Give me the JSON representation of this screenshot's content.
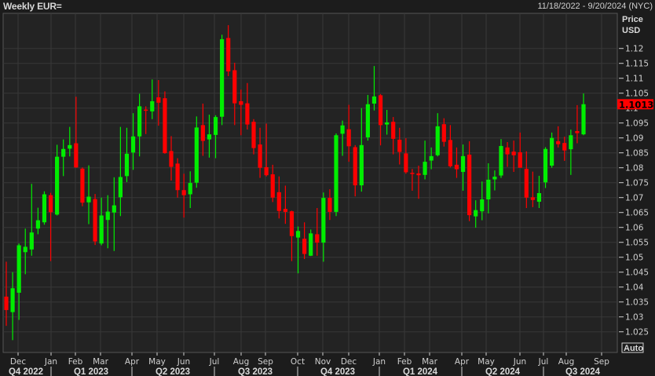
{
  "header": {
    "title": "Weekly EUR=",
    "range": "11/18/2022 - 9/20/2024 (NYC)"
  },
  "chart_data": {
    "type": "candlestick",
    "title": "Weekly EUR=",
    "ylabel": "Price USD",
    "ylabel_lines": [
      "Price",
      "USD"
    ],
    "ylim": [
      1.02,
      1.13
    ],
    "yticks": [
      "1.12",
      "1.115",
      "1.11",
      "1.105",
      "1.1",
      "1.095",
      "1.09",
      "1.085",
      "1.08",
      "1.075",
      "1.07",
      "1.065",
      "1.06",
      "1.055",
      "1.05",
      "1.045",
      "1.04",
      "1.035",
      "1.03",
      "1.025"
    ],
    "grid": true,
    "last_price": "1.1013",
    "scale_button": "Auto",
    "months": [
      "Dec",
      "Jan",
      "Feb",
      "Mar",
      "Apr",
      "May",
      "Jun",
      "Jul",
      "Aug",
      "Sep",
      "Oct",
      "Nov",
      "Dec",
      "Jan",
      "Feb",
      "Mar",
      "Apr",
      "May",
      "Jun",
      "Jul",
      "Aug",
      "Sep"
    ],
    "quarters": [
      "Q4 2022",
      "Q1 2023",
      "Q2 2023",
      "Q3 2023",
      "Q4 2023",
      "Q1 2024",
      "Q2 2024",
      "Q3 2024"
    ],
    "colors": {
      "up": "#00ee00",
      "down": "#ff0000",
      "last_price_bg": "#ff0000"
    },
    "candle_fields": [
      "open",
      "high",
      "low",
      "close"
    ],
    "candles": [
      [
        1.0368,
        1.0485,
        1.027,
        1.0323
      ],
      [
        1.0316,
        1.045,
        1.0222,
        1.0396
      ],
      [
        1.0381,
        1.0546,
        1.029,
        1.054
      ],
      [
        1.0517,
        1.0596,
        1.0443,
        1.0535
      ],
      [
        1.0526,
        1.0746,
        1.0505,
        1.0583
      ],
      [
        1.0596,
        1.0666,
        1.0577,
        1.0624
      ],
      [
        1.0617,
        1.0721,
        1.0609,
        1.0711
      ],
      [
        1.0708,
        1.0716,
        1.0487,
        1.0651
      ],
      [
        1.0643,
        1.0877,
        1.064,
        1.0837
      ],
      [
        1.0837,
        1.0895,
        1.0772,
        1.0863
      ],
      [
        1.0864,
        1.0937,
        1.0838,
        1.0876
      ],
      [
        1.0882,
        1.1038,
        1.08,
        1.0801
      ],
      [
        1.0797,
        1.0801,
        1.0671,
        1.0683
      ],
      [
        1.0684,
        1.0808,
        1.0611,
        1.0703
      ],
      [
        1.0695,
        1.0712,
        1.0541,
        1.0553
      ],
      [
        1.0546,
        1.07,
        1.054,
        1.064
      ],
      [
        1.0625,
        1.0708,
        1.053,
        1.0653
      ],
      [
        1.065,
        1.0768,
        1.0521,
        1.0674
      ],
      [
        1.0701,
        1.0937,
        1.0638,
        1.0769
      ],
      [
        1.0772,
        1.0934,
        1.0752,
        1.0847
      ],
      [
        1.0851,
        1.0983,
        1.0793,
        1.0905
      ],
      [
        1.0905,
        1.1048,
        1.0838,
        1.1006
      ],
      [
        1.0995,
        1.1006,
        1.0913,
        1.0993
      ],
      [
        1.0989,
        1.1096,
        1.0963,
        1.1023
      ],
      [
        1.1036,
        1.1094,
        1.0941,
        1.1018
      ],
      [
        1.1033,
        1.1056,
        1.0847,
        1.0849
      ],
      [
        1.0856,
        1.0906,
        1.0757,
        1.0803
      ],
      [
        1.0814,
        1.0832,
        1.07,
        1.0725
      ],
      [
        1.0725,
        1.078,
        1.0633,
        1.0708
      ],
      [
        1.0711,
        1.0788,
        1.0665,
        1.0749
      ],
      [
        1.075,
        1.0972,
        1.0733,
        1.0935
      ],
      [
        1.0943,
        1.1015,
        1.084,
        1.089
      ],
      [
        1.0895,
        1.0978,
        1.0834,
        1.0912
      ],
      [
        1.091,
        1.0976,
        1.0832,
        1.097
      ],
      [
        1.0971,
        1.1246,
        1.0943,
        1.1231
      ],
      [
        1.1235,
        1.1278,
        1.1107,
        1.1123
      ],
      [
        1.1127,
        1.1152,
        1.0943,
        1.1016
      ],
      [
        1.1023,
        1.1062,
        1.0909,
        1.1011
      ],
      [
        1.1016,
        1.1084,
        1.0928,
        1.0945
      ],
      [
        1.0954,
        1.0963,
        1.0845,
        1.0866
      ],
      [
        1.0878,
        1.0934,
        1.0766,
        1.08
      ],
      [
        1.0802,
        1.0948,
        1.0771,
        1.0775
      ],
      [
        1.0778,
        1.081,
        1.0685,
        1.07
      ],
      [
        1.0718,
        1.0771,
        1.063,
        1.0655
      ],
      [
        1.0662,
        1.074,
        1.0612,
        1.0652
      ],
      [
        1.0654,
        1.0656,
        1.0487,
        1.0571
      ],
      [
        1.0566,
        1.0603,
        1.0446,
        1.0588
      ],
      [
        1.0562,
        1.0617,
        1.0494,
        1.0511
      ],
      [
        1.0505,
        1.0593,
        1.0504,
        1.058
      ],
      [
        1.0577,
        1.0665,
        1.0505,
        1.0549
      ],
      [
        1.0549,
        1.0717,
        1.0485,
        1.0699
      ],
      [
        1.0699,
        1.0728,
        1.0625,
        1.0652
      ],
      [
        1.0652,
        1.0915,
        1.0638,
        1.0909
      ],
      [
        1.0914,
        1.0958,
        1.084,
        1.0942
      ],
      [
        1.0929,
        1.1011,
        1.082,
        1.0872
      ],
      [
        1.0869,
        1.0876,
        1.0704,
        1.0741
      ],
      [
        1.0741,
        1.1,
        1.072,
        1.0876
      ],
      [
        1.0902,
        1.1044,
        1.0891,
        1.1013
      ],
      [
        1.1015,
        1.1141,
        1.0992,
        1.1039
      ],
      [
        1.1043,
        1.1047,
        1.0875,
        1.0943
      ],
      [
        1.0945,
        1.0994,
        1.0911,
        1.0952
      ],
      [
        1.0954,
        1.097,
        1.0845,
        1.0897
      ],
      [
        1.0894,
        1.0934,
        1.0811,
        1.0853
      ],
      [
        1.0848,
        1.0899,
        1.078,
        1.0785
      ],
      [
        1.0783,
        1.0796,
        1.0723,
        1.0782
      ],
      [
        1.0781,
        1.0807,
        1.0696,
        1.0775
      ],
      [
        1.0776,
        1.0891,
        1.0761,
        1.082
      ],
      [
        1.0824,
        1.0868,
        1.0795,
        1.0839
      ],
      [
        1.0842,
        1.0983,
        1.0838,
        1.0939
      ],
      [
        1.0946,
        1.0966,
        1.0871,
        1.0887
      ],
      [
        1.0893,
        1.0943,
        1.0801,
        1.0805
      ],
      [
        1.081,
        1.0868,
        1.0766,
        1.0795
      ],
      [
        1.0786,
        1.0878,
        1.0723,
        1.0839
      ],
      [
        1.0844,
        1.0889,
        1.0621,
        1.0641
      ],
      [
        1.0637,
        1.0691,
        1.0599,
        1.0658
      ],
      [
        1.0654,
        1.0754,
        1.0624,
        1.0694
      ],
      [
        1.0694,
        1.0815,
        1.0647,
        1.076
      ],
      [
        1.0761,
        1.0791,
        1.0724,
        1.077
      ],
      [
        1.0774,
        1.0896,
        1.0766,
        1.0873
      ],
      [
        1.0868,
        1.0886,
        1.0803,
        1.0845
      ],
      [
        1.0854,
        1.0891,
        1.0786,
        1.0842
      ],
      [
        1.0852,
        1.0918,
        1.08,
        1.08
      ],
      [
        1.0796,
        1.0855,
        1.0665,
        1.07
      ],
      [
        1.0701,
        1.0787,
        1.0668,
        1.0692
      ],
      [
        1.0686,
        1.0773,
        1.0665,
        1.0715
      ],
      [
        1.0751,
        1.0869,
        1.0732,
        1.0863
      ],
      [
        1.0807,
        1.0918,
        1.08,
        1.09
      ],
      [
        1.0889,
        1.0939,
        1.0868,
        1.0879
      ],
      [
        1.0883,
        1.0904,
        1.0823,
        1.0858
      ],
      [
        1.0862,
        1.0928,
        1.0776,
        1.0909
      ],
      [
        1.0923,
        1.101,
        1.0882,
        1.0916
      ],
      [
        1.0912,
        1.1049,
        1.0909,
        1.1013
      ]
    ]
  }
}
